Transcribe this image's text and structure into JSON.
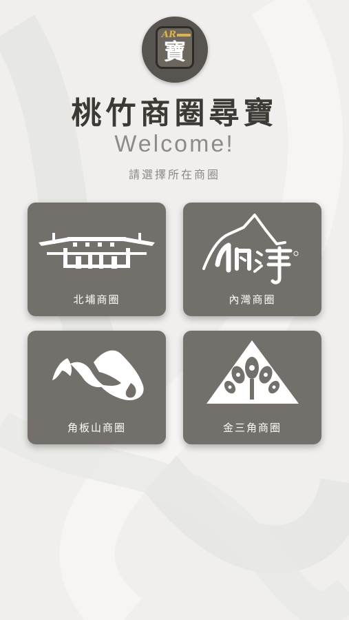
{
  "app": {
    "logo": {
      "ar_text": "AR",
      "char": "寶",
      "icon": "ar-treasure-logo-icon"
    },
    "title": "桃竹商圈尋寶",
    "welcome": "Welcome!",
    "prompt": "請選擇所在商圈"
  },
  "districts": [
    {
      "label": "北埔商圈",
      "icon": "beipu-gate-icon"
    },
    {
      "label": "內灣商圈",
      "icon": "neiwan-mountain-icon"
    },
    {
      "label": "角板山商圈",
      "icon": "jiaobanshan-brush-icon"
    },
    {
      "label": "金三角商圈",
      "icon": "jinsanjiao-triangle-icon"
    }
  ],
  "colors": {
    "background": "#f0efed",
    "card": "#736f6b",
    "title": "#3d3a36",
    "welcome": "#8e8b86",
    "logo_accent": "#e0b24a"
  }
}
